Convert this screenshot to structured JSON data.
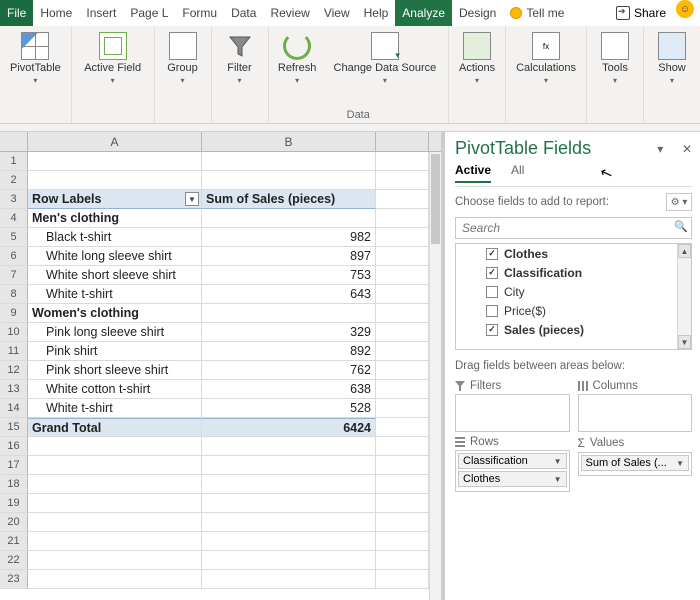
{
  "tabs": [
    "File",
    "Home",
    "Insert",
    "Page L",
    "Formu",
    "Data",
    "Review",
    "View",
    "Help",
    "Analyze",
    "Design"
  ],
  "tabs_active_index": 9,
  "tell_me": "Tell me",
  "share": "Share",
  "ribbon": {
    "pivottable": "PivotTable",
    "active_field": "Active Field",
    "group": "Group",
    "filter": "Filter",
    "refresh": "Refresh",
    "change_source": "Change Data Source",
    "actions": "Actions",
    "calculations": "Calculations",
    "tools": "Tools",
    "show": "Show",
    "group_data_label": "Data"
  },
  "columns": [
    "A",
    "B"
  ],
  "sheet": {
    "header_a": "Row Labels",
    "header_b": "Sum of Sales (pieces)",
    "groups": [
      {
        "label": "Men's clothing",
        "items": [
          {
            "name": "Black t-shirt",
            "val": "982"
          },
          {
            "name": "White long sleeve shirt",
            "val": "897"
          },
          {
            "name": "White short sleeve shirt",
            "val": "753"
          },
          {
            "name": "White t-shirt",
            "val": "643"
          }
        ]
      },
      {
        "label": "Women's clothing",
        "items": [
          {
            "name": "Pink long sleeve shirt",
            "val": "329"
          },
          {
            "name": "Pink shirt",
            "val": "892"
          },
          {
            "name": "Pink short sleeve shirt",
            "val": "762"
          },
          {
            "name": "White cotton t-shirt",
            "val": "638"
          },
          {
            "name": "White t-shirt",
            "val": "528"
          }
        ]
      }
    ],
    "grand_label": "Grand Total",
    "grand_val": "6424"
  },
  "pane": {
    "title": "PivotTable Fields",
    "tab_active": "Active",
    "tab_all": "All",
    "choose": "Choose fields to add to report:",
    "search_placeholder": "Search",
    "fields": [
      {
        "name": "Clothes",
        "checked": true
      },
      {
        "name": "Classification",
        "checked": true
      },
      {
        "name": "City",
        "checked": false
      },
      {
        "name": "Price($)",
        "checked": false
      },
      {
        "name": "Sales (pieces)",
        "checked": true
      }
    ],
    "drag_hint": "Drag fields between areas below:",
    "area_filters": "Filters",
    "area_columns": "Columns",
    "area_rows": "Rows",
    "area_values": "Values",
    "rows_pills": [
      "Classification",
      "Clothes"
    ],
    "values_pill": "Sum of Sales (..."
  }
}
